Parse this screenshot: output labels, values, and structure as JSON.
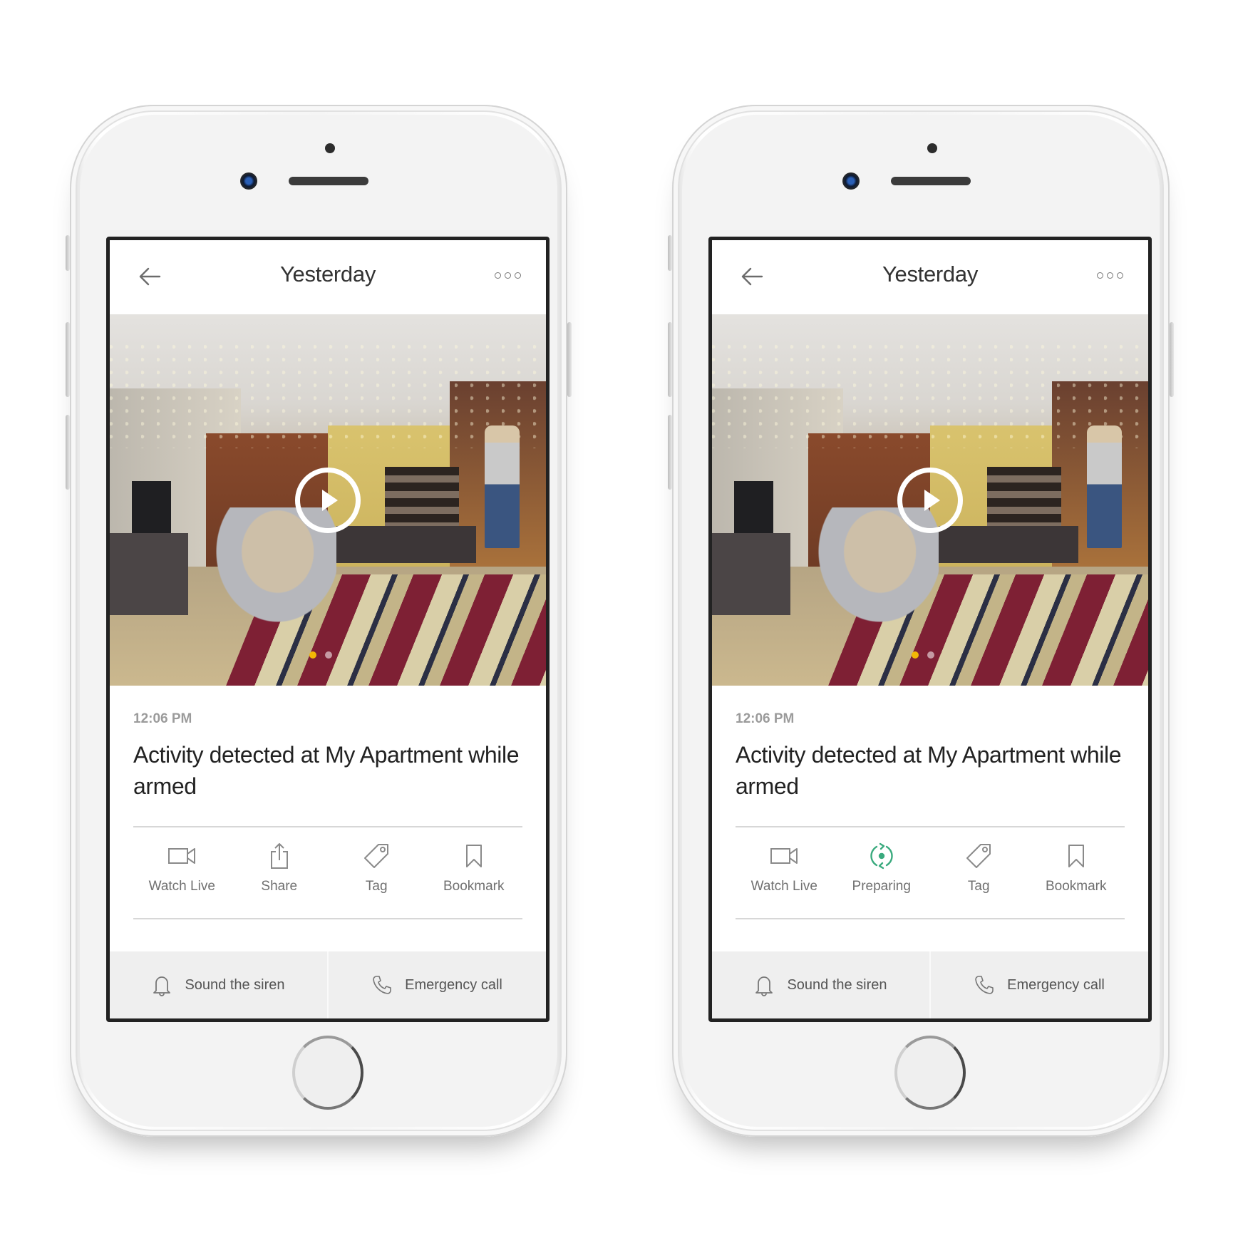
{
  "colors": {
    "accent_yellow": "#f2b705",
    "preparing_green": "#3aaa7e",
    "text_dark": "#222222",
    "text_muted": "#9b9b9b",
    "bottom_bar_bg": "#efefef"
  },
  "phones": [
    {
      "header": {
        "title": "Yesterday",
        "back_icon": "arrow-left-icon",
        "more_icon": "more-dots-icon"
      },
      "video": {
        "play_icon": "play-icon",
        "page_count": 2,
        "active_page": 1
      },
      "event": {
        "timestamp": "12:06 PM",
        "title": "Activity detected at My Apartment while armed"
      },
      "actions": [
        {
          "label": "Watch Live",
          "icon": "video-camera-icon",
          "state": "default"
        },
        {
          "label": "Share",
          "icon": "share-icon",
          "state": "default"
        },
        {
          "label": "Tag",
          "icon": "tag-icon",
          "state": "default"
        },
        {
          "label": "Bookmark",
          "icon": "bookmark-icon",
          "state": "default"
        }
      ],
      "bottom_bar": [
        {
          "label": "Sound the siren",
          "icon": "bell-icon"
        },
        {
          "label": "Emergency call",
          "icon": "phone-icon"
        }
      ]
    },
    {
      "header": {
        "title": "Yesterday",
        "back_icon": "arrow-left-icon",
        "more_icon": "more-dots-icon"
      },
      "video": {
        "play_icon": "play-icon",
        "page_count": 2,
        "active_page": 1
      },
      "event": {
        "timestamp": "12:06 PM",
        "title": "Activity detected at My Apartment while armed"
      },
      "actions": [
        {
          "label": "Watch Live",
          "icon": "video-camera-icon",
          "state": "default"
        },
        {
          "label": "Preparing",
          "icon": "sync-icon",
          "state": "preparing"
        },
        {
          "label": "Tag",
          "icon": "tag-icon",
          "state": "default"
        },
        {
          "label": "Bookmark",
          "icon": "bookmark-icon",
          "state": "default"
        }
      ],
      "bottom_bar": [
        {
          "label": "Sound the siren",
          "icon": "bell-icon"
        },
        {
          "label": "Emergency call",
          "icon": "phone-icon"
        }
      ]
    }
  ]
}
